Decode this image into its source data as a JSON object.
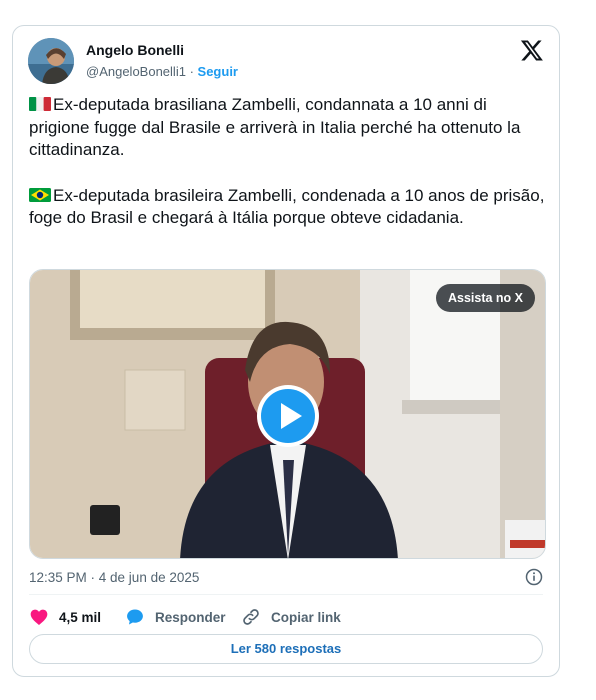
{
  "author": {
    "name": "Angelo Bonelli",
    "handle": "@AngeloBonelli1",
    "separator": "·",
    "follow_label": "Seguir"
  },
  "tweet": {
    "paragraphs": [
      {
        "flag": "italy-flag-icon",
        "text": "Ex-deputada brasiliana Zambelli, condannata a 10 anni di prigione fugge dal Brasile e arriverà in Italia perché ha ottenuto la cittadinanza."
      },
      {
        "flag": "brazil-flag-icon",
        "text": "Ex-deputada brasileira Zambelli, condenada a 10 anos de prisão, foge do Brasil e chegará à Itália porque obteve cidadania."
      }
    ]
  },
  "media": {
    "watch_label": "Assista no X"
  },
  "timestamp": "12:35 PM · 4 de jun de 2025",
  "actions": {
    "likes": "4,5 mil",
    "reply_label": "Responder",
    "copy_link_label": "Copiar link"
  },
  "read_replies_label": "Ler 580 respostas",
  "colors": {
    "accent": "#1d9bf0",
    "like": "#f91880",
    "text_secondary": "#536471"
  }
}
